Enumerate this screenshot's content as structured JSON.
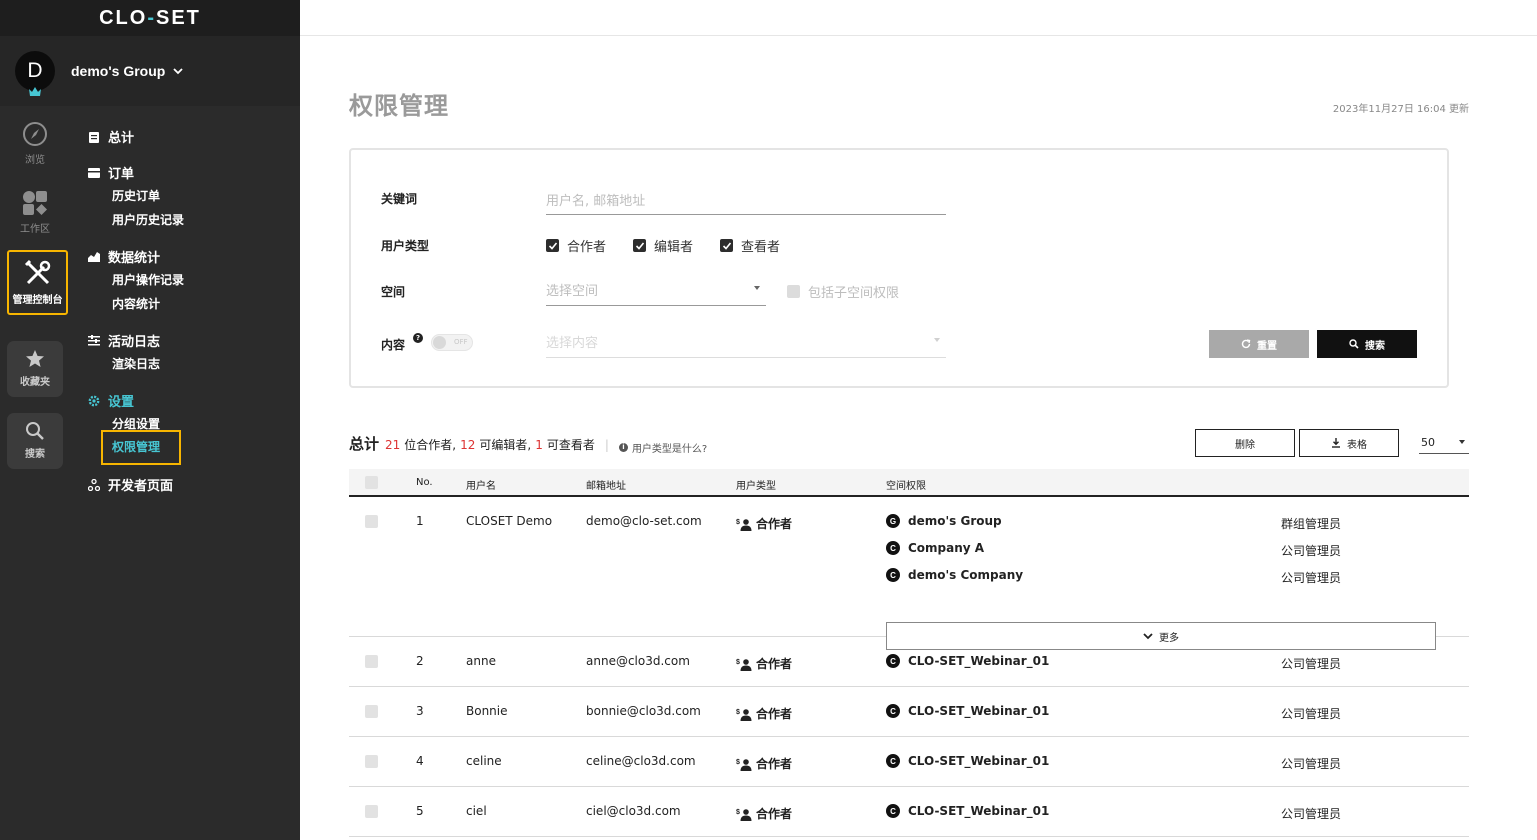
{
  "app": {
    "logo_left": "CLO",
    "logo_dash": "-",
    "logo_right": "SET"
  },
  "group": {
    "avatar_letter": "D",
    "name": "demo's Group"
  },
  "rail": {
    "browse": "浏览",
    "workspace": "工作区",
    "admin": "管理控制台",
    "favorites": "收藏夹",
    "search": "搜索"
  },
  "menu": {
    "summary": "总计",
    "orders": "订单",
    "order_history": "历史订单",
    "user_history": "用户历史记录",
    "stats": "数据统计",
    "user_actions": "用户操作记录",
    "content_stats": "内容统计",
    "activity": "活动日志",
    "render_log": "渲染日志",
    "settings": "设置",
    "group_settings": "分组设置",
    "permissions": "权限管理",
    "developer": "开发者页面"
  },
  "page": {
    "title": "权限管理",
    "updated": "2023年11月27日 16:04 更新"
  },
  "filter": {
    "keyword_label": "关键词",
    "keyword_placeholder": "用户名, 邮箱地址",
    "usertype_label": "用户类型",
    "types": [
      "合作者",
      "编辑者",
      "查看者"
    ],
    "space_label": "空间",
    "space_placeholder": "选择空间",
    "include_sub": "包括子空间权限",
    "content_label": "内容",
    "content_help": "?",
    "toggle_state": "OFF",
    "content_placeholder": "选择内容",
    "reset": "重置",
    "search": "搜索"
  },
  "summary": {
    "label": "总计",
    "collab_count": "21",
    "collab_text": "位合作者,",
    "editor_count": "12",
    "editor_text": "可编辑者,",
    "viewer_count": "1",
    "viewer_text": "可查看者",
    "help": "用户类型是什么?",
    "delete": "删除",
    "sheet": "表格",
    "page_size": "50"
  },
  "table": {
    "headers": {
      "no": "No.",
      "user": "用户名",
      "email": "邮箱地址",
      "type": "用户类型",
      "perm": "空间权限"
    },
    "more": "更多",
    "rows": [
      {
        "no": "1",
        "user": "CLOSET Demo",
        "email": "demo@clo-set.com",
        "type": "合作者",
        "perms": [
          {
            "badge": "G",
            "space": "demo's Group",
            "role": "群组管理员"
          },
          {
            "badge": "C",
            "space": "Company A",
            "role": "公司管理员"
          },
          {
            "badge": "C",
            "space": "demo's Company",
            "role": "公司管理员"
          }
        ]
      },
      {
        "no": "2",
        "user": "anne",
        "email": "anne@clo3d.com",
        "type": "合作者",
        "perms": [
          {
            "badge": "C",
            "space": "CLO-SET_Webinar_01",
            "role": "公司管理员"
          }
        ]
      },
      {
        "no": "3",
        "user": "Bonnie",
        "email": "bonnie@clo3d.com",
        "type": "合作者",
        "perms": [
          {
            "badge": "C",
            "space": "CLO-SET_Webinar_01",
            "role": "公司管理员"
          }
        ]
      },
      {
        "no": "4",
        "user": "celine",
        "email": "celine@clo3d.com",
        "type": "合作者",
        "perms": [
          {
            "badge": "C",
            "space": "CLO-SET_Webinar_01",
            "role": "公司管理员"
          }
        ]
      },
      {
        "no": "5",
        "user": "ciel",
        "email": "ciel@clo3d.com",
        "type": "合作者",
        "perms": [
          {
            "badge": "C",
            "space": "CLO-SET_Webinar_01",
            "role": "公司管理员"
          }
        ]
      }
    ]
  },
  "colors": {
    "accent": "#47c6d3",
    "highlight": "#f7b500",
    "count": "#dd3333"
  }
}
